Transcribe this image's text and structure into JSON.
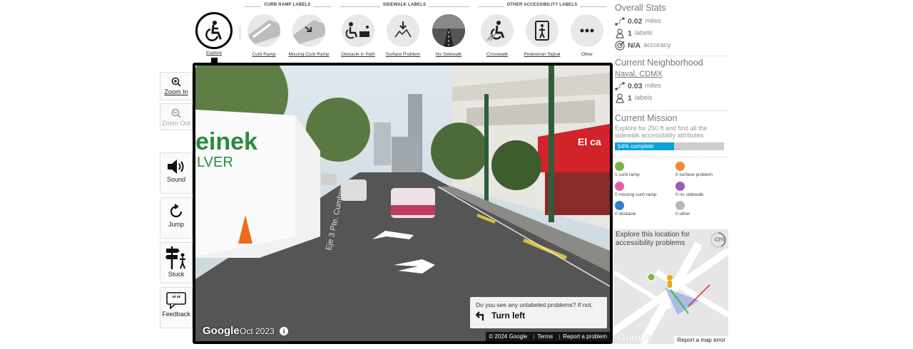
{
  "toolbar": {
    "groups": {
      "curb_ramp": "CURB RAMP LABELS",
      "sidewalk": "SIDEWALK LABELS",
      "other": "OTHER ACCESSIBILITY LABELS"
    },
    "tools": [
      {
        "label": "Explore",
        "icon": "wheelchair-icon",
        "active": true
      },
      {
        "label": "Curb Ramp",
        "icon": "curb-ramp-icon"
      },
      {
        "label": "Missing Curb Ramp",
        "icon": "missing-curb-ramp-icon"
      },
      {
        "label": "Obstacle in Path",
        "icon": "obstacle-icon"
      },
      {
        "label": "Surface Problem",
        "icon": "surface-problem-icon"
      },
      {
        "label": "No Sidewalk",
        "icon": "no-sidewalk-icon"
      },
      {
        "label": "Crosswalk",
        "icon": "crosswalk-icon"
      },
      {
        "label": "Pedestrian Signal",
        "icon": "pedestrian-signal-icon"
      },
      {
        "label": "Other",
        "icon": "more-icon"
      }
    ]
  },
  "controls": {
    "zoom_in": "Zoom In",
    "zoom_out": "Zoom Out",
    "sound": "Sound",
    "jump": "Jump",
    "stuck": "Stuck",
    "feedback": "Feedback"
  },
  "pano": {
    "logo": "Google",
    "date": "Oct 2023",
    "info": "i",
    "hint_question": "Do you see any unlabeled problems? If not,",
    "hint_action": "Turn left",
    "attribution": [
      "© 2024 Google",
      "Terms",
      "Report a problem"
    ],
    "truck_text_1": "einek",
    "truck_text_2": "LVER",
    "sign_text": "El ca",
    "street_text": "Eje 3 Pte. Cumbres"
  },
  "overall": {
    "title": "Overall Stats",
    "miles": "0.02",
    "miles_unit": "miles",
    "labels": "1",
    "labels_unit": "labels",
    "accuracy": "N/A",
    "accuracy_unit": "accuracy"
  },
  "neighborhood": {
    "title": "Current Neighborhood",
    "name": "Naval, CDMX",
    "miles": "0.03",
    "miles_unit": "miles",
    "labels": "1",
    "labels_unit": "labels"
  },
  "mission": {
    "title": "Current Mission",
    "description": "Explore for 250 ft and find all the sidewalk accessibility attributes",
    "progress_text": "54% complete",
    "progress": 0.54
  },
  "label_counts": [
    {
      "text": "1 curb ramp",
      "color": "#7bb548"
    },
    {
      "text": "0 surface problem",
      "color": "#f28a2e"
    },
    {
      "text": "0 missing curb ramp",
      "color": "#e35fa4"
    },
    {
      "text": "0 no sidewalk",
      "color": "#9c5bb0"
    },
    {
      "text": "0 obstacle",
      "color": "#2d82c8"
    },
    {
      "text": "0 other",
      "color": "#b8b8b8"
    }
  ],
  "minimap": {
    "text": "Explore this location for accessibility problems",
    "percent": "43%",
    "logo": "Google",
    "report": "Report a map error"
  }
}
